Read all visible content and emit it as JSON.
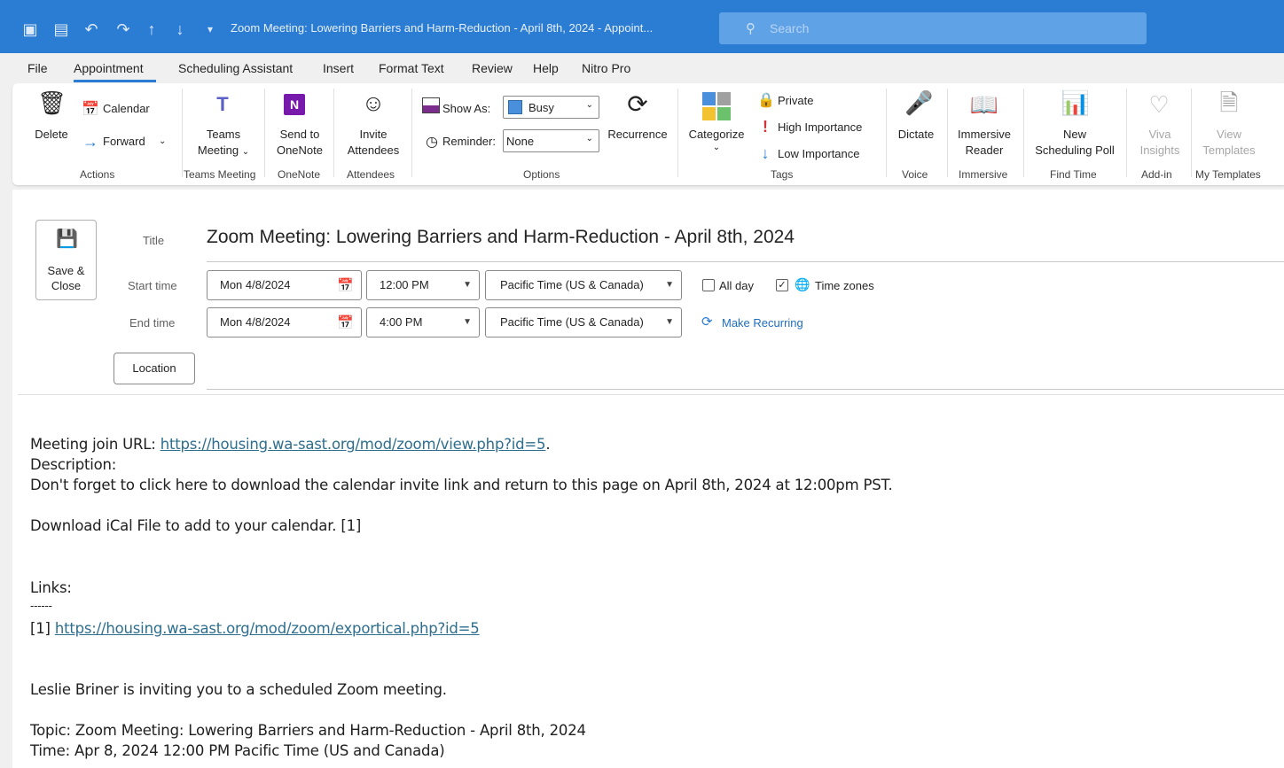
{
  "titlebar": {
    "window_title": "Zoom Meeting: Lowering Barriers and Harm-Reduction - April 8th, 2024  -  Appoint...",
    "search_placeholder": "Search"
  },
  "menu": {
    "tabs": [
      "File",
      "Appointment",
      "Scheduling Assistant",
      "Insert",
      "Format Text",
      "Review",
      "Help",
      "Nitro Pro"
    ],
    "active": "Appointment"
  },
  "ribbon": {
    "actions": {
      "delete": "Delete",
      "calendar": "Calendar",
      "forward": "Forward",
      "group": "Actions"
    },
    "teams": {
      "label1": "Teams",
      "label2": "Meeting",
      "group": "Teams Meeting"
    },
    "onenote": {
      "label1": "Send to",
      "label2": "OneNote",
      "group": "OneNote"
    },
    "attendees": {
      "label1": "Invite",
      "label2": "Attendees",
      "group": "Attendees"
    },
    "options": {
      "show_as_label": "Show As:",
      "show_as_value": "Busy",
      "reminder_label": "Reminder:",
      "reminder_value": "None",
      "recurrence": "Recurrence",
      "group": "Options"
    },
    "tags": {
      "categorize": "Categorize",
      "private": "Private",
      "high": "High Importance",
      "low": "Low Importance",
      "group": "Tags"
    },
    "voice": {
      "dictate": "Dictate",
      "group": "Voice"
    },
    "immersive": {
      "label1": "Immersive",
      "label2": "Reader",
      "group": "Immersive"
    },
    "findtime": {
      "label1": "New",
      "label2": "Scheduling Poll",
      "group": "Find Time"
    },
    "addin": {
      "label1": "Viva",
      "label2": "Insights",
      "group": "Add-in"
    },
    "templates": {
      "label1": "View",
      "label2": "Templates",
      "group": "My Templates"
    }
  },
  "form": {
    "save_close_1": "Save &",
    "save_close_2": "Close",
    "title_label": "Title",
    "title_value": "Zoom Meeting: Lowering Barriers and Harm-Reduction - April 8th, 2024",
    "start_label": "Start time",
    "end_label": "End time",
    "start_date": "Mon 4/8/2024",
    "start_time": "12:00 PM",
    "start_tz": "Pacific Time (US & Canada)",
    "end_date": "Mon 4/8/2024",
    "end_time": "4:00 PM",
    "end_tz": "Pacific Time (US & Canada)",
    "all_day": "All day",
    "time_zones": "Time zones",
    "make_recurring": "Make Recurring",
    "location": "Location"
  },
  "body": {
    "join_prefix": "Meeting join URL: ",
    "join_url": "https://housing.wa-sast.org/mod/zoom/view.php?id=5",
    "join_suffix": ".",
    "description": "Description:",
    "reminder_line": "Don't forget to click here to download the calendar invite link and return to this page on April 8th, 2024 at 12:00pm PST.",
    "ical_line": "Download iCal File to add to your calendar. [1]",
    "links": "Links:",
    "dashes": "------",
    "ref_prefix": "[1] ",
    "ref_url": "https://housing.wa-sast.org/mod/zoom/exportical.php?id=5",
    "inviting": "Leslie Briner is inviting you to a scheduled Zoom meeting.",
    "topic": "Topic: Zoom Meeting: Lowering Barriers and Harm-Reduction - April 8th, 2024",
    "time": "Time: Apr 8, 2024 12:00 PM Pacific Time (US and Canada)"
  },
  "colors": {
    "titlebar": "#2b7cd3",
    "accent": "#2b7cd3",
    "link": "#2e6e8e"
  }
}
